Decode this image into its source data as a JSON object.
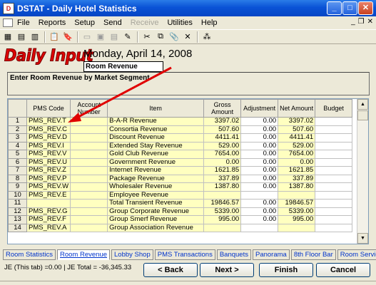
{
  "window": {
    "title": "DSTAT - Daily Hotel Statistics",
    "app_icon": "D"
  },
  "menu": {
    "items": [
      "File",
      "Reports",
      "Setup",
      "Send",
      "Receive",
      "Utilities",
      "Help"
    ],
    "disabled": [
      "Receive"
    ]
  },
  "header": {
    "logo_text": "Daily Input",
    "date": "Monday, April 14, 2008",
    "section": "Room Revenue"
  },
  "instructions": "Enter Room Revenue by Market Segment.",
  "grid": {
    "columns": [
      "PMS Code",
      "Account Number",
      "Item",
      "Gross Amount",
      "Adjustment",
      "Net Amount",
      "Budget"
    ],
    "rows": [
      {
        "n": "1",
        "code": "PMS_REV.T",
        "acct": "",
        "item": "B-A-R Revenue",
        "gross": "3397.02",
        "adj": "0.00",
        "net": "3397.02",
        "budget": ""
      },
      {
        "n": "2",
        "code": "PMS_REV.C",
        "acct": "",
        "item": "Consortia Revenue",
        "gross": "507.60",
        "adj": "0.00",
        "net": "507.60",
        "budget": ""
      },
      {
        "n": "3",
        "code": "PMS_REV.D",
        "acct": "",
        "item": "Discount Revenue",
        "gross": "4411.41",
        "adj": "0.00",
        "net": "4411.41",
        "budget": ""
      },
      {
        "n": "4",
        "code": "PMS_REV.I",
        "acct": "",
        "item": "Extended Stay Revenue",
        "gross": "529.00",
        "adj": "0.00",
        "net": "529.00",
        "budget": ""
      },
      {
        "n": "5",
        "code": "PMS_REV.V",
        "acct": "",
        "item": "Gold Club Revenue",
        "gross": "7654.00",
        "adj": "0.00",
        "net": "7654.00",
        "budget": ""
      },
      {
        "n": "6",
        "code": "PMS_REV.U",
        "acct": "",
        "item": "Government Revenue",
        "gross": "0.00",
        "adj": "0.00",
        "net": "0.00",
        "budget": ""
      },
      {
        "n": "7",
        "code": "PMS_REV.Z",
        "acct": "",
        "item": "Internet Revenue",
        "gross": "1621.85",
        "adj": "0.00",
        "net": "1621.85",
        "budget": ""
      },
      {
        "n": "8",
        "code": "PMS_REV.P",
        "acct": "",
        "item": "Package Revenue",
        "gross": "337.89",
        "adj": "0.00",
        "net": "337.89",
        "budget": ""
      },
      {
        "n": "9",
        "code": "PMS_REV.W",
        "acct": "",
        "item": "Wholesaler Revenue",
        "gross": "1387.80",
        "adj": "0.00",
        "net": "1387.80",
        "budget": ""
      },
      {
        "n": "10",
        "code": "PMS_REV.E",
        "acct": "",
        "item": "Employee Revenue",
        "gross": "",
        "adj": "",
        "net": "",
        "budget": ""
      },
      {
        "n": "11",
        "code": "",
        "acct": "",
        "item": "Total Transient Revenue",
        "gross": "19846.57",
        "adj": "0.00",
        "net": "19846.57",
        "budget": ""
      },
      {
        "n": "12",
        "code": "PMS_REV.G",
        "acct": "",
        "item": "Group Corporate Revenue",
        "gross": "5339.00",
        "adj": "0.00",
        "net": "5339.00",
        "budget": ""
      },
      {
        "n": "13",
        "code": "PMS_REV.F",
        "acct": "",
        "item": "Group Smerf Revenue",
        "gross": "995.00",
        "adj": "0.00",
        "net": "995.00",
        "budget": ""
      },
      {
        "n": "14",
        "code": "PMS_REV.A",
        "acct": "",
        "item": "Group Association Revenue",
        "gross": "",
        "adj": "",
        "net": "",
        "budget": ""
      }
    ]
  },
  "tabs": [
    "Room Statistics",
    "Room Revenue",
    "Lobby Shop",
    "PMS Transactions",
    "Banquets",
    "Panorama",
    "8th Floor Bar",
    "Room Service"
  ],
  "active_tab": "Room Revenue",
  "status": "JE (This tab) =0.00 | JE Total = -36,345.33",
  "buttons": {
    "back": "< Back",
    "next": "Next >",
    "finish": "Finish",
    "cancel": "Cancel"
  },
  "colors": {
    "highlight": "#ffffc0",
    "logo": "#e00000",
    "titlebar": "#0a52d6",
    "arrow": "#e00000"
  }
}
